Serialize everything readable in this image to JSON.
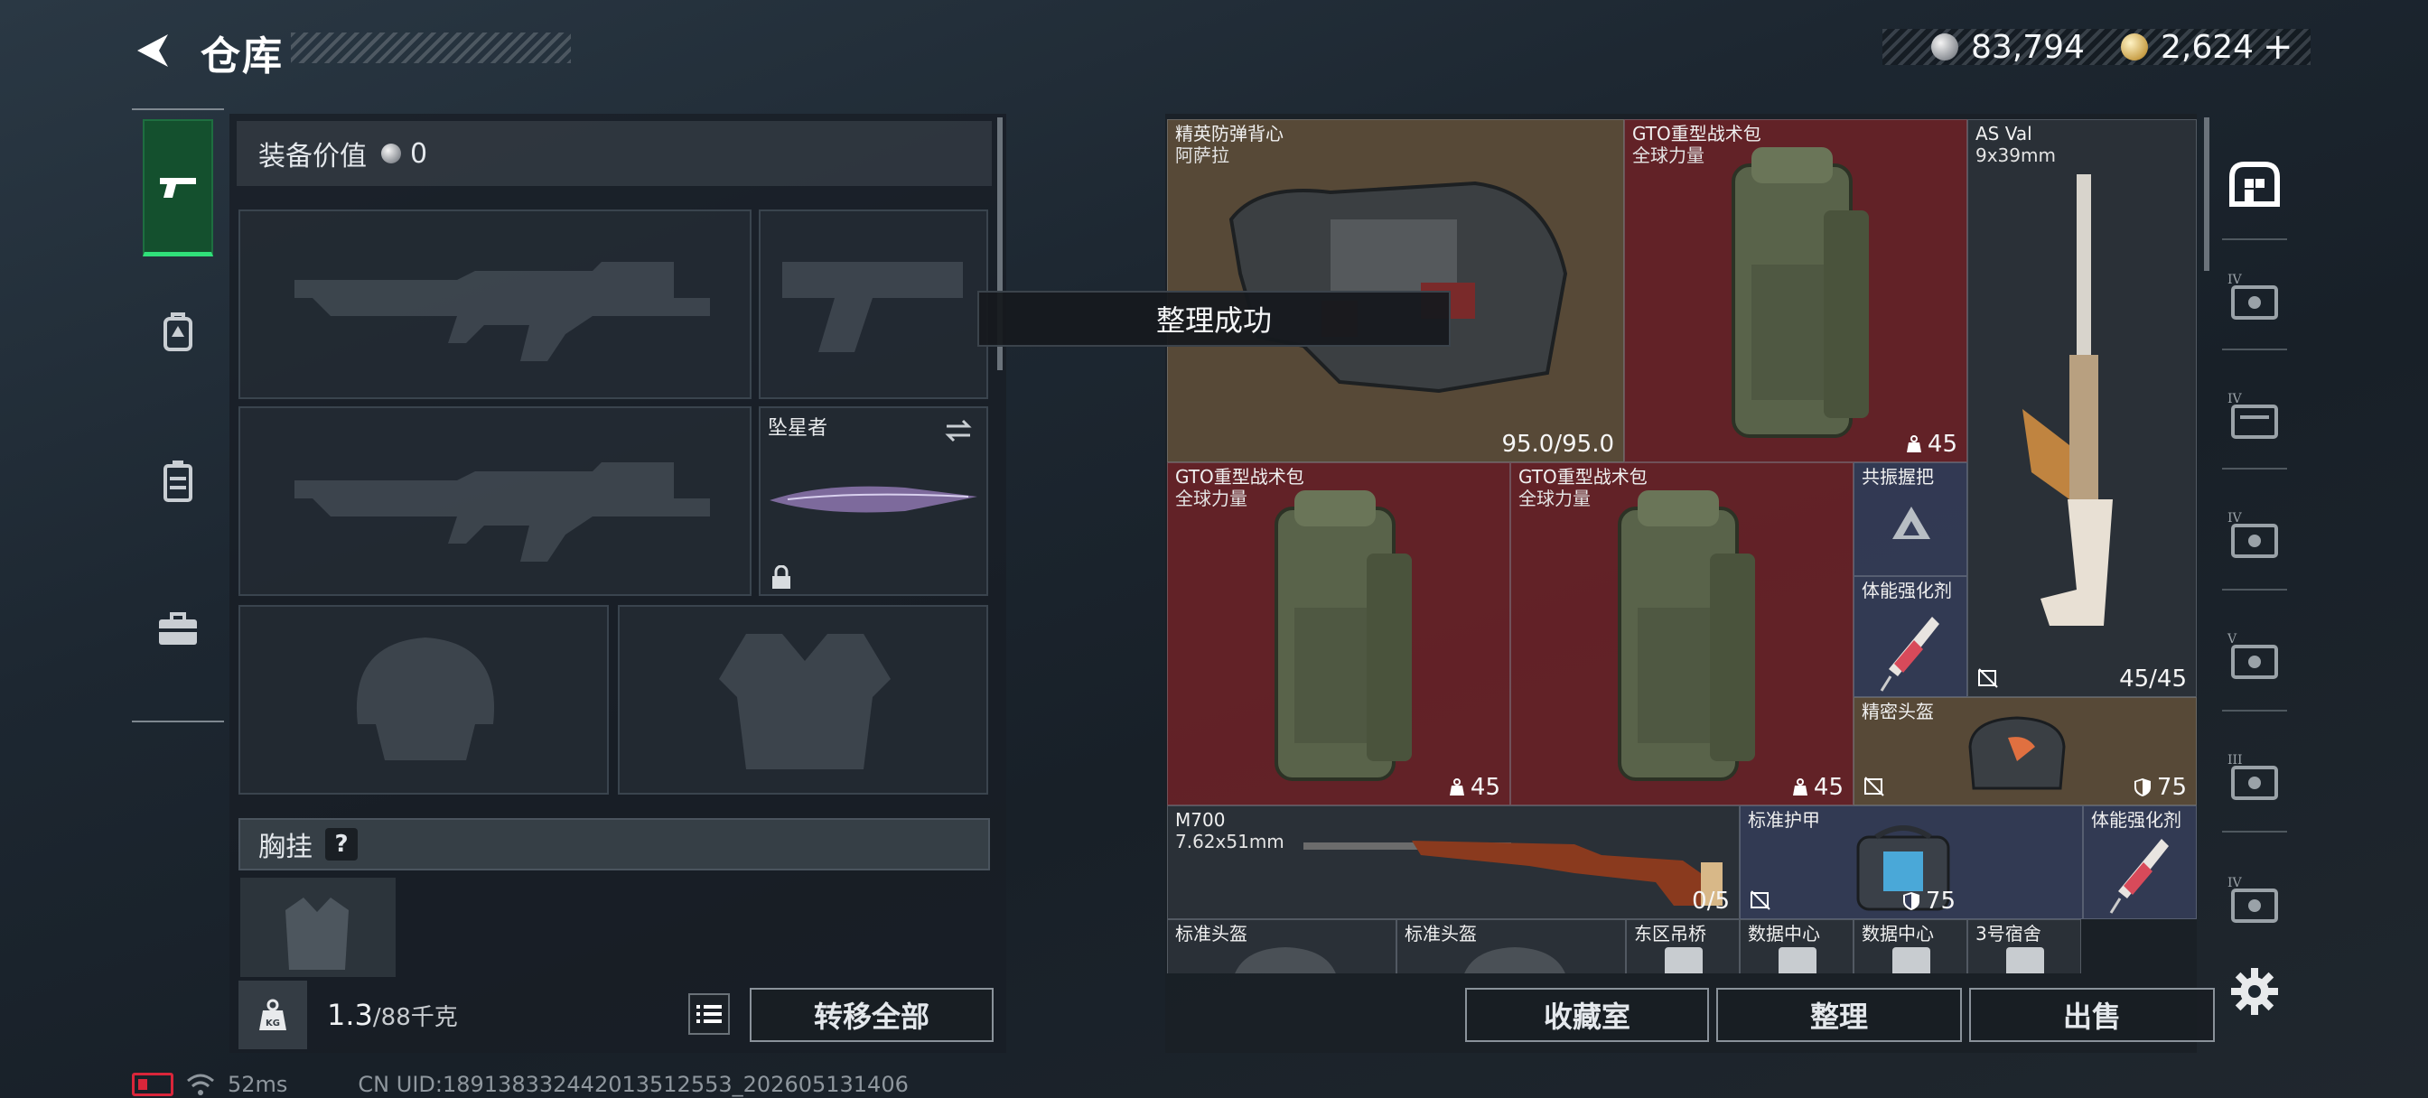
{
  "header": {
    "title": "仓库",
    "currency_silver": "83,794",
    "currency_gold": "2,624",
    "currency_add": "+"
  },
  "left_tabs": [
    {
      "name": "weapons",
      "icon": "pistol-icon",
      "active": true
    },
    {
      "name": "gear",
      "icon": "backpack-icon",
      "active": false
    },
    {
      "name": "consumables",
      "icon": "canister-icon",
      "active": false
    },
    {
      "name": "toolbox",
      "icon": "toolbox-icon",
      "active": false
    }
  ],
  "equipment": {
    "value_label": "装备价值",
    "value": "0",
    "melee_slot_label": "坠星者",
    "chest_rig_label": "胸挂",
    "chest_rig_help": "?",
    "weight_current": "1.3",
    "weight_max": "/88千克",
    "move_all_label": "转移全部"
  },
  "toast": "整理成功",
  "stash": {
    "items": [
      {
        "name": "精英防弹背心",
        "sub": "阿萨拉",
        "stat": "95.0/95.0"
      },
      {
        "name": "GTO重型战术包",
        "sub": "全球力量",
        "stat": "45"
      },
      {
        "name": "AS Val",
        "sub": "9x39mm",
        "stat": "45/45"
      },
      {
        "name": "GTO重型战术包",
        "sub": "全球力量",
        "stat": "45"
      },
      {
        "name": "GTO重型战术包",
        "sub": "全球力量",
        "stat": "45"
      },
      {
        "name": "共振握把",
        "sub": "",
        "stat": ""
      },
      {
        "name": "体能强化剂",
        "sub": "",
        "stat": ""
      },
      {
        "name": "精密头盔",
        "sub": "",
        "stat": "75"
      },
      {
        "name": "M700",
        "sub": "7.62x51mm",
        "stat": "0/5"
      },
      {
        "name": "标准护甲",
        "sub": "",
        "stat": "75"
      },
      {
        "name": "体能强化剂",
        "sub": "",
        "stat": ""
      },
      {
        "name": "标准头盔",
        "sub": "",
        "stat": ""
      },
      {
        "name": "标准头盔",
        "sub": "",
        "stat": ""
      },
      {
        "name": "东区吊桥",
        "sub": "",
        "stat": ""
      },
      {
        "name": "数据中心",
        "sub": "",
        "stat": ""
      },
      {
        "name": "数据中心",
        "sub": "",
        "stat": ""
      },
      {
        "name": "3号宿舍",
        "sub": "",
        "stat": ""
      }
    ],
    "buttons": {
      "collection": "收藏室",
      "sort": "整理",
      "sell": "出售"
    }
  },
  "right_rail": [
    {
      "icon": "stash-home-icon",
      "tier": ""
    },
    {
      "icon": "tier-case-icon",
      "tier": "IV"
    },
    {
      "icon": "tier-case-icon",
      "tier": "IV"
    },
    {
      "icon": "tier-case-icon",
      "tier": "IV"
    },
    {
      "icon": "tier-case-icon",
      "tier": "V"
    },
    {
      "icon": "tier-case-icon",
      "tier": "III"
    },
    {
      "icon": "tier-case-icon",
      "tier": "IV"
    }
  ],
  "footer": {
    "ping": "52ms",
    "uid": "CN UID:18913833244201351255​3_202605131406"
  },
  "colors": {
    "accent_green": "#30e07a",
    "red_rarity": "#6c2228",
    "gold_rarity": "#604e3a",
    "blue_rarity": "#363e5a",
    "battery_red": "#d9263a"
  }
}
